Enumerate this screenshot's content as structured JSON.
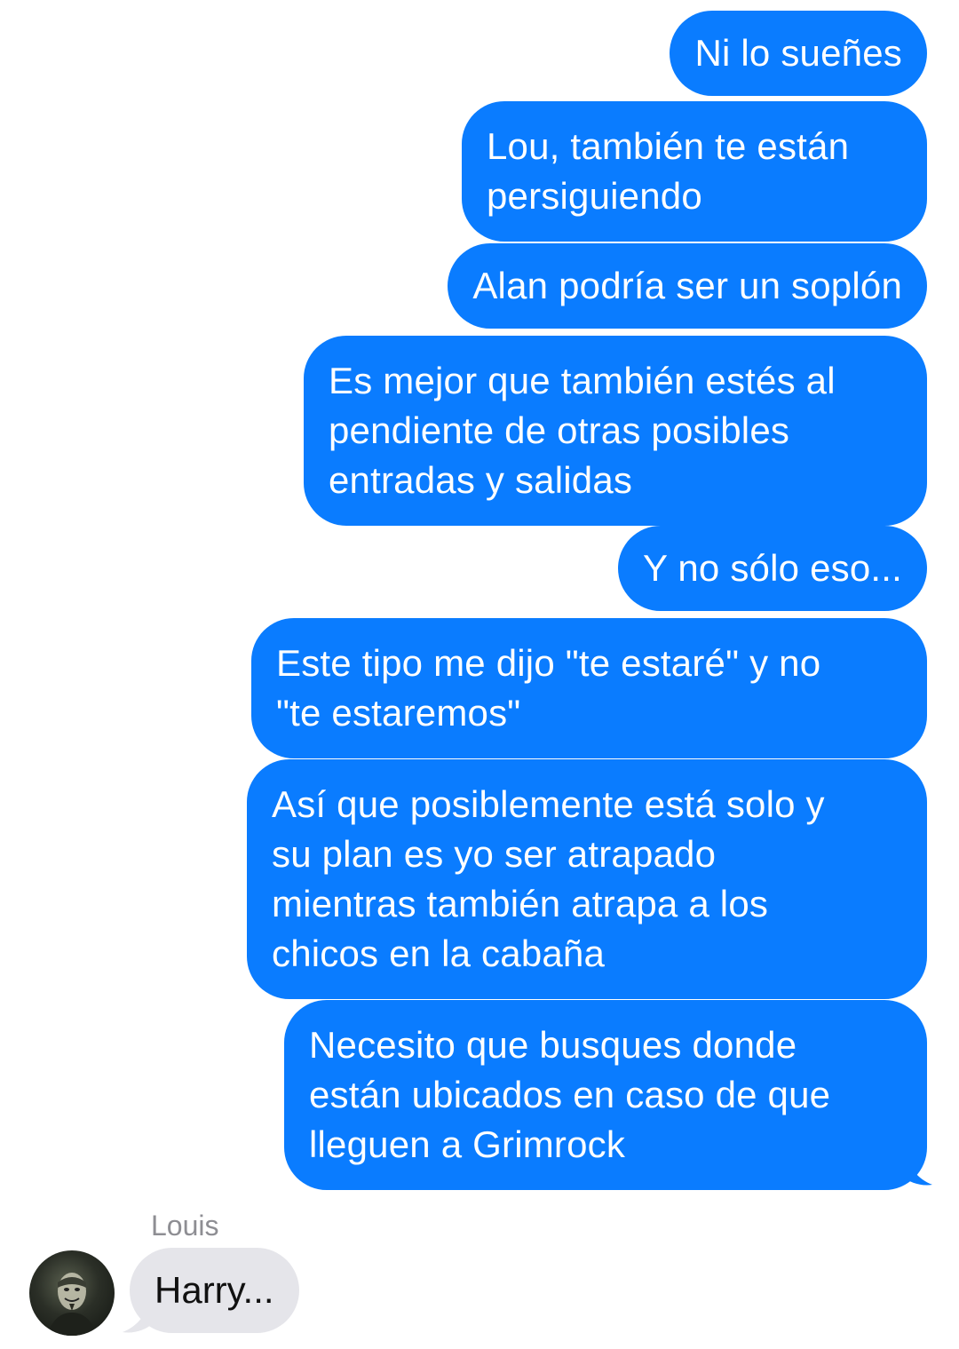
{
  "messages_outgoing": [
    {
      "text": "Ni lo sueñes"
    },
    {
      "text": "Lou, también te están\npersiguiendo"
    },
    {
      "text": "Alan podría ser un soplón"
    },
    {
      "text": "Es mejor que también estés al\npendiente de otras posibles\nentradas y salidas"
    },
    {
      "text": "Y no sólo eso..."
    },
    {
      "text": "Este tipo me dijo \"te estaré\" y no\n\"te estaremos\""
    },
    {
      "text": "Así que posiblemente está solo y\nsu plan es yo ser atrapado\nmientras también atrapa a los\nchicos en la cabaña"
    },
    {
      "text": "Necesito que busques donde\nestán ubicados en caso de que\nlleguen a Grimrock"
    }
  ],
  "incoming": {
    "sender": "Louis",
    "text": "Harry..."
  },
  "colors": {
    "outgoing_bubble": "#0a7cff",
    "incoming_bubble": "#e5e5ea",
    "sender_name": "#8e8e93"
  }
}
